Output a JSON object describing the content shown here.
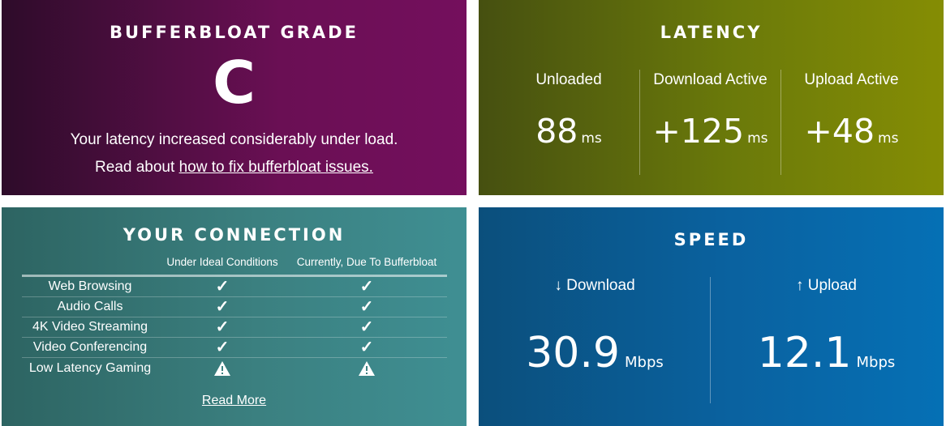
{
  "grade": {
    "title": "BUFFERBLOAT GRADE",
    "letter": "C",
    "description": "Your latency increased considerably under load.",
    "read_prefix": "Read about ",
    "read_link": "how to fix bufferbloat issues."
  },
  "latency": {
    "title": "LATENCY",
    "columns": [
      {
        "label": "Unloaded",
        "value": "88",
        "unit": "ms"
      },
      {
        "label": "Download Active",
        "value": "+125",
        "unit": "ms"
      },
      {
        "label": "Upload Active",
        "value": "+48",
        "unit": "ms"
      }
    ]
  },
  "connection": {
    "title": "YOUR CONNECTION",
    "headers": {
      "name": "",
      "ideal": "Under Ideal Conditions",
      "current": "Currently, Due To Bufferbloat"
    },
    "rows": [
      {
        "name": "Web Browsing",
        "ideal": "check",
        "current": "check"
      },
      {
        "name": "Audio Calls",
        "ideal": "check",
        "current": "check"
      },
      {
        "name": "4K Video Streaming",
        "ideal": "check",
        "current": "check"
      },
      {
        "name": "Video Conferencing",
        "ideal": "check",
        "current": "check"
      },
      {
        "name": "Low Latency Gaming",
        "ideal": "warning",
        "current": "warning"
      }
    ],
    "read_more": "Read More",
    "check_glyph": "✓"
  },
  "speed": {
    "title": "SPEED",
    "download": {
      "label": "↓ Download",
      "value": "30.9",
      "unit": "Mbps"
    },
    "upload": {
      "label": "↑ Upload",
      "value": "12.1",
      "unit": "Mbps"
    }
  },
  "colors": {
    "grade_bg": "#6a0f54",
    "latency_bg": "#6b7a0a",
    "connection_bg": "#3b8080",
    "speed_bg": "#0a62a0"
  }
}
